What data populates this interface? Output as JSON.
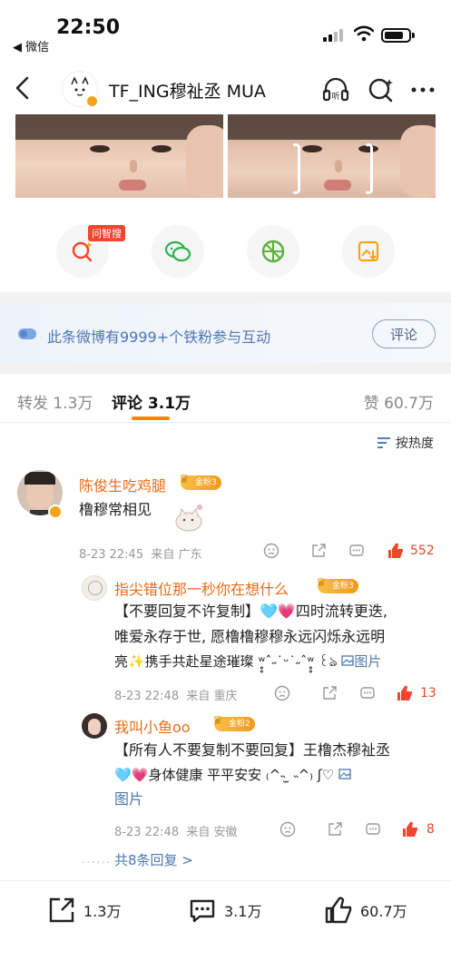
{
  "status": {
    "time": "22:50",
    "back_app": "◀ 微信"
  },
  "nav": {
    "title": "TF_ING穆祉丞 MUA",
    "listen_label": "听"
  },
  "share": {
    "ai_tag": "问智搜"
  },
  "banner": {
    "text": "此条微博有9999+个铁粉参与互动",
    "button": "评论"
  },
  "tabs": {
    "repost": "转发 1.3万",
    "comment": "评论 3.1万",
    "like": "赞 60.7万"
  },
  "sort": {
    "label": "按热度"
  },
  "comments": [
    {
      "name": "陈俊生吃鸡腿",
      "badge": "金粉3",
      "text": "橹穆常相见",
      "time": "8-23 22:45",
      "location": "来自 广东",
      "likes": "552"
    }
  ],
  "replies": [
    {
      "name": "指尖错位那一秒你在想什么",
      "badge": "金粉3",
      "line1": "【不要回复不许复制】🩵💗四时流转更迭,",
      "line2": "唯爱永存于世, 愿橹橹穆穆永远闪烁永远明",
      "line3a": "亮✨携手共赴星途璀璨 ʷ̥̥ˆ˶˙ᵕ˙˶ˆʷ̥̥ ꒰ঌ",
      "line3b": "图片",
      "time": "8-23 22:48",
      "location": "来自 重庆",
      "likes": "13"
    },
    {
      "name": "我叫小鱼oo",
      "badge": "金粉2",
      "line1": "【所有人不要复制不要回复】王橹杰穆祉丞",
      "line2": "🩵💗身体健康 平平安安 ₍^˵ ̫ ˵^₎ ʃ♡",
      "line3b": "图片",
      "time": "8-23 22:48",
      "location": "来自 安徽",
      "likes": "8"
    }
  ],
  "more_replies": "共8条回复 >",
  "bottom": {
    "repost": "1.3万",
    "comment": "3.1万",
    "like": "60.7万"
  },
  "colors": {
    "accent": "#ff8200",
    "name": "#e86b18",
    "link": "#4d78b3"
  }
}
